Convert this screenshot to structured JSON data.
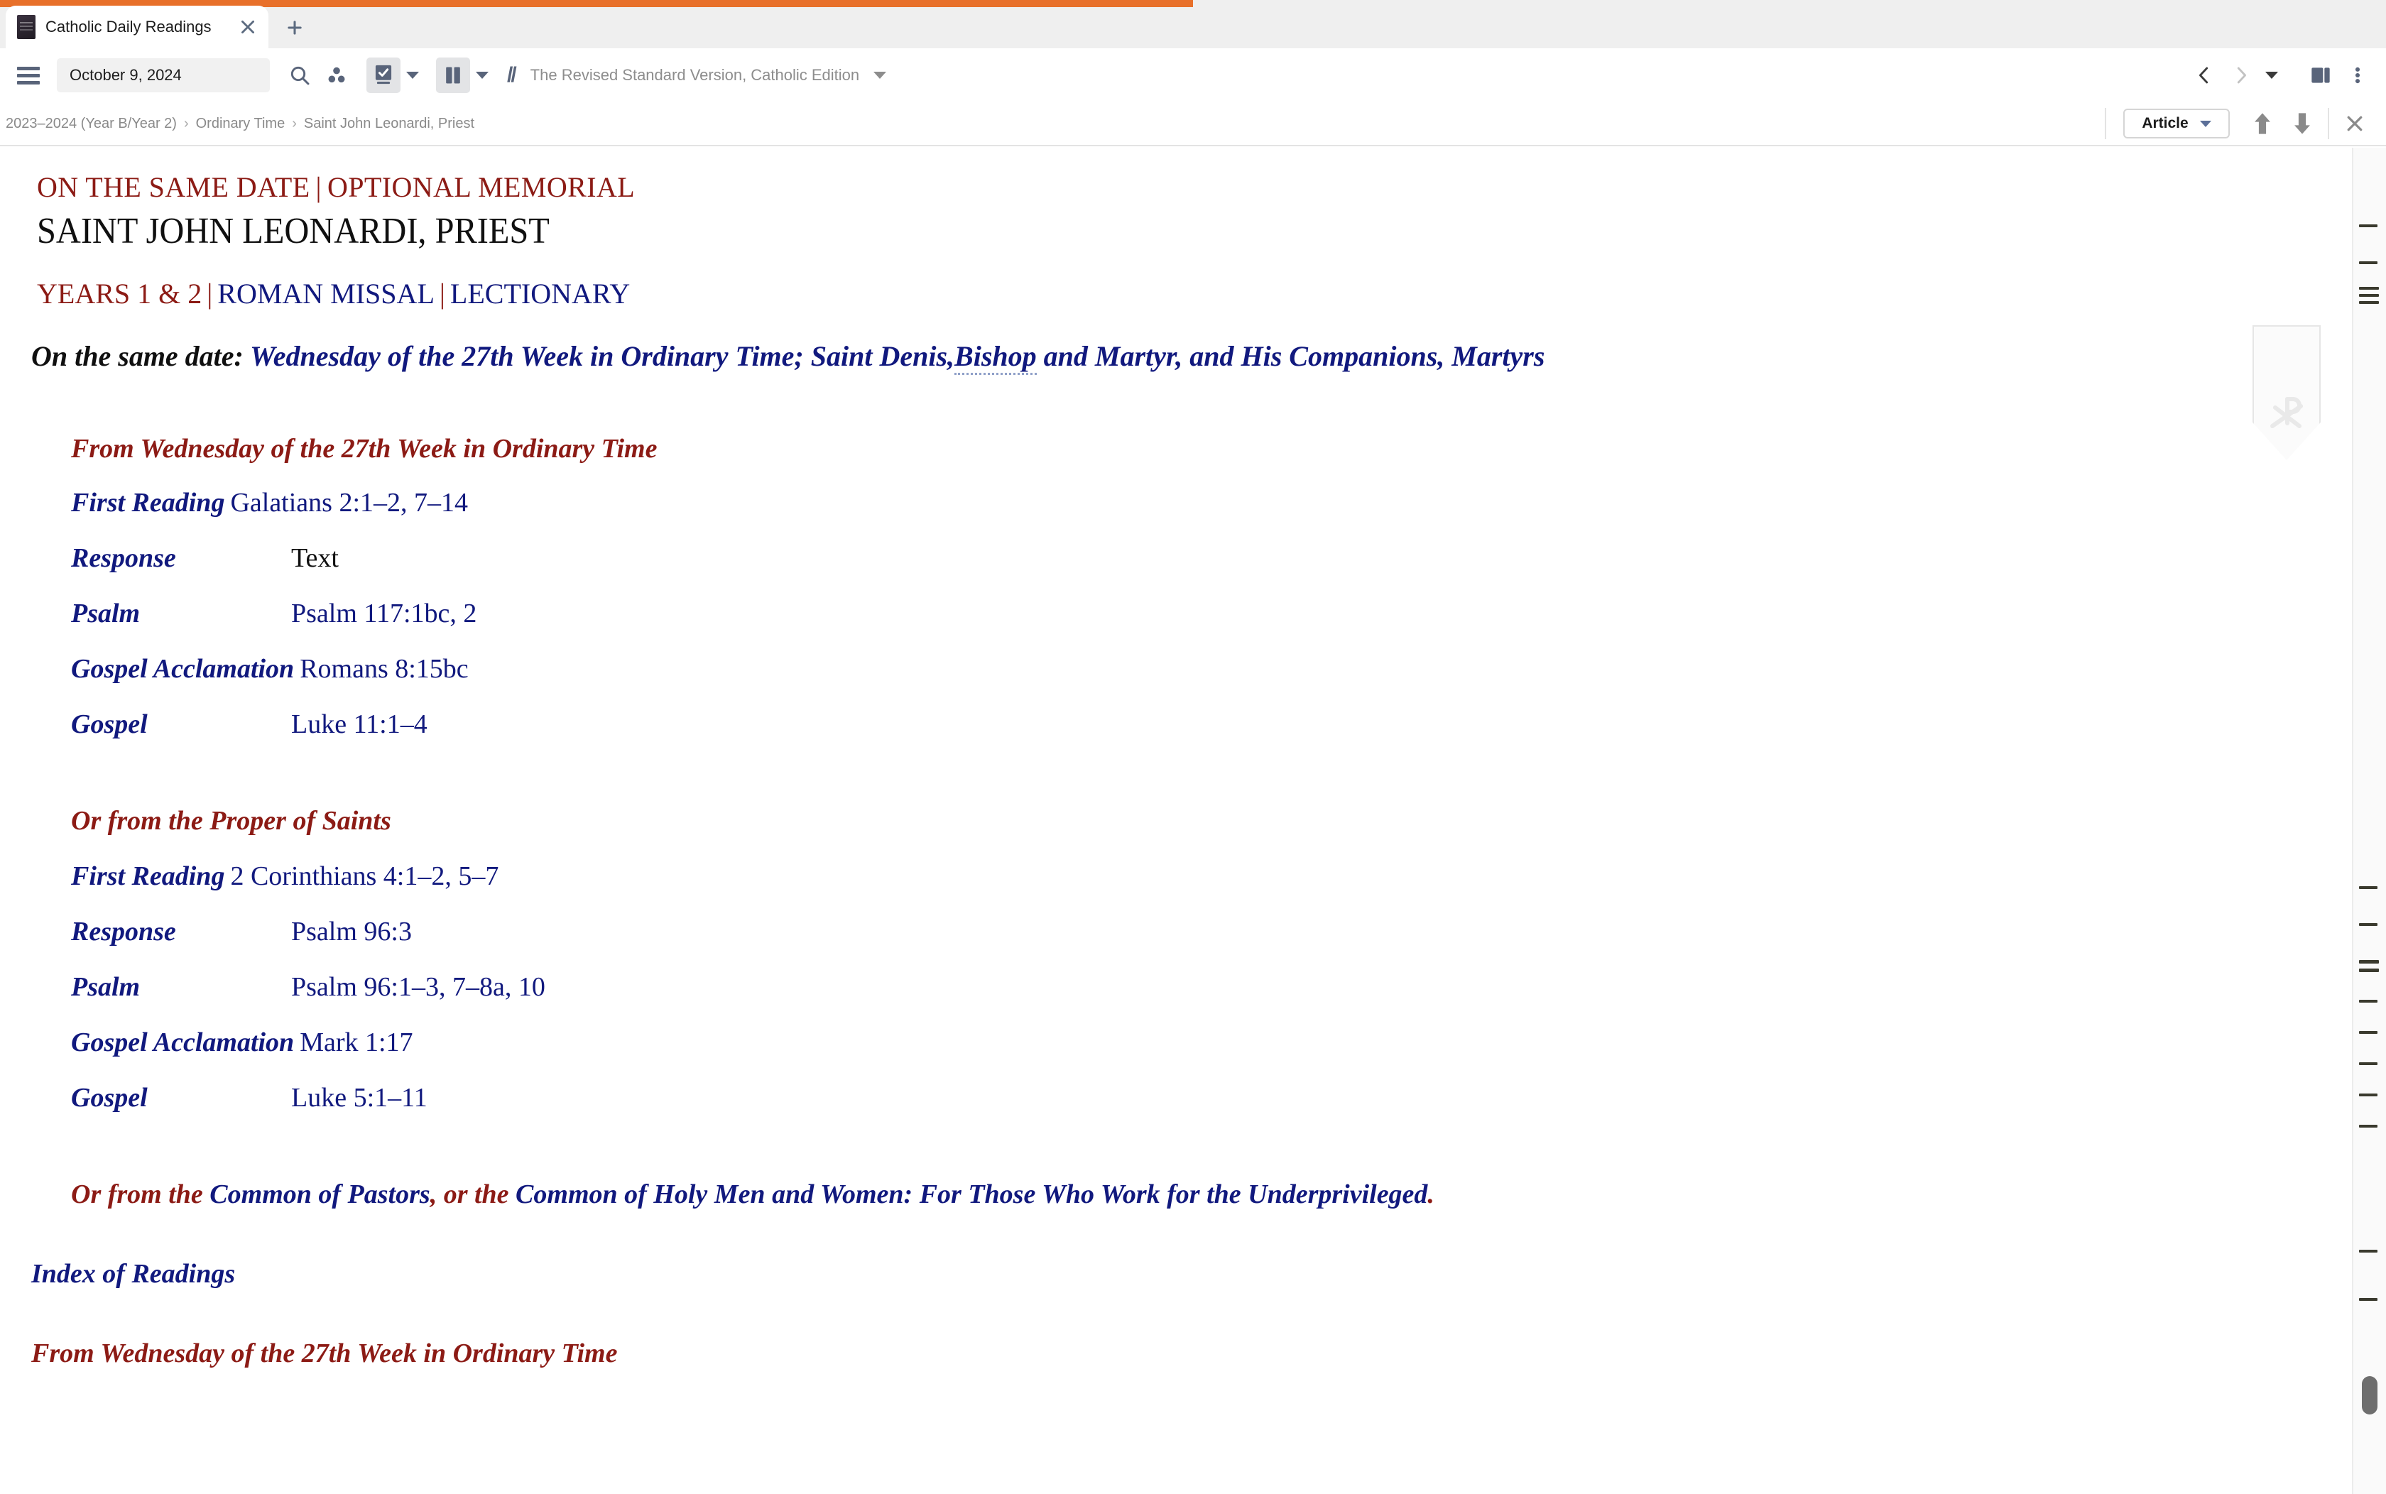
{
  "browser": {
    "accent_color": "#e8702a",
    "tab": {
      "title": "Catholic Daily Readings",
      "close_label": "×",
      "favicon_name": "book-cover-favicon"
    },
    "new_tab_label": "+"
  },
  "toolbar": {
    "menu_icon": "hamburger-icon",
    "date_value": "October 9, 2024",
    "date_placeholder": "Date",
    "search_icon": "search-icon",
    "group_icon": "three-dots-cluster-icon",
    "book_icon": "checked-book-icon",
    "columns_icon": "two-column-layout-icon",
    "parallel_icon": "double-slash-icon",
    "parallel_label": "//",
    "version_label": "The Revised Standard Version, Catholic Edition",
    "back_label": "‹",
    "forward_label": "›",
    "history_caret": "▾",
    "split_icon": "split-view-icon",
    "overflow_icon": "kebab-menu-icon"
  },
  "crumbbar": {
    "crumbs": [
      "2023–2024 (Year B/Year 2)",
      "Ordinary Time",
      "Saint John Leonardi, Priest"
    ],
    "separator": "›",
    "article_label": "Article",
    "prev_label": "↑",
    "next_label": "↓",
    "close_label": "×"
  },
  "document": {
    "kicker_left": "ON THE SAME DATE",
    "kicker_right": "OPTIONAL MEMORIAL",
    "divider": "|",
    "title": "SAINT JOHN LEONARDI, PRIEST",
    "sub_years": "YEARS 1 & 2",
    "sub_missal": "ROMAN MISSAL",
    "sub_lectionary": "LECTIONARY",
    "same_date_label": "On the same date:",
    "same_date_link_a": "Wednesday of the 27th Week in Ordinary Time;",
    "same_date_link_b_pre": "Saint Denis,",
    "same_date_link_b_dotted": "Bishop",
    "same_date_link_b_post": "and Martyr, and His Companions, Martyrs",
    "section_one_heading": "From Wednesday of the 27th Week in Ordinary Time",
    "section_one_rows": [
      {
        "label": "First Reading",
        "value": "Galatians 2:1–2, 7–14",
        "plain": false,
        "tight": true
      },
      {
        "label": "Response",
        "value": "Text",
        "plain": true,
        "tight": false
      },
      {
        "label": "Psalm",
        "value": "Psalm 117:1bc, 2",
        "plain": false,
        "tight": false
      },
      {
        "label": "Gospel Acclamation",
        "value": "Romans 8:15bc",
        "plain": false,
        "tight": true
      },
      {
        "label": "Gospel",
        "value": "Luke 11:1–4",
        "plain": false,
        "tight": false
      }
    ],
    "section_two_heading": "Or from the Proper of Saints",
    "section_two_rows": [
      {
        "label": "First Reading",
        "value": "2 Corinthians 4:1–2, 5–7",
        "plain": false,
        "tight": true
      },
      {
        "label": "Response",
        "value": "Psalm 96:3",
        "plain": false,
        "tight": false
      },
      {
        "label": "Psalm",
        "value": "Psalm 96:1–3, 7–8a, 10",
        "plain": false,
        "tight": false
      },
      {
        "label": "Gospel Acclamation",
        "value": "Mark 1:17",
        "plain": false,
        "tight": true
      },
      {
        "label": "Gospel",
        "value": "Luke 5:1–11",
        "plain": false,
        "tight": false
      }
    ],
    "common_a": "Or from the",
    "common_b": "Common of Pastors",
    "common_c": ", or the",
    "common_d": "Common of Holy Men and Women: For Those Who Work for the Underprivileged",
    "common_e": ".",
    "index_heading": "Index of Readings",
    "from_heading": "From Wednesday of the 27th Week in Ordinary Time"
  },
  "watermark": {
    "ribbon_name": "bookmark-ribbon-watermark",
    "symbol": "chi-rho"
  },
  "colors": {
    "dark_red": "#8c1b15",
    "navy": "#11197e",
    "accent_orange": "#e8702a",
    "toolbar_icon": "#59647a"
  }
}
